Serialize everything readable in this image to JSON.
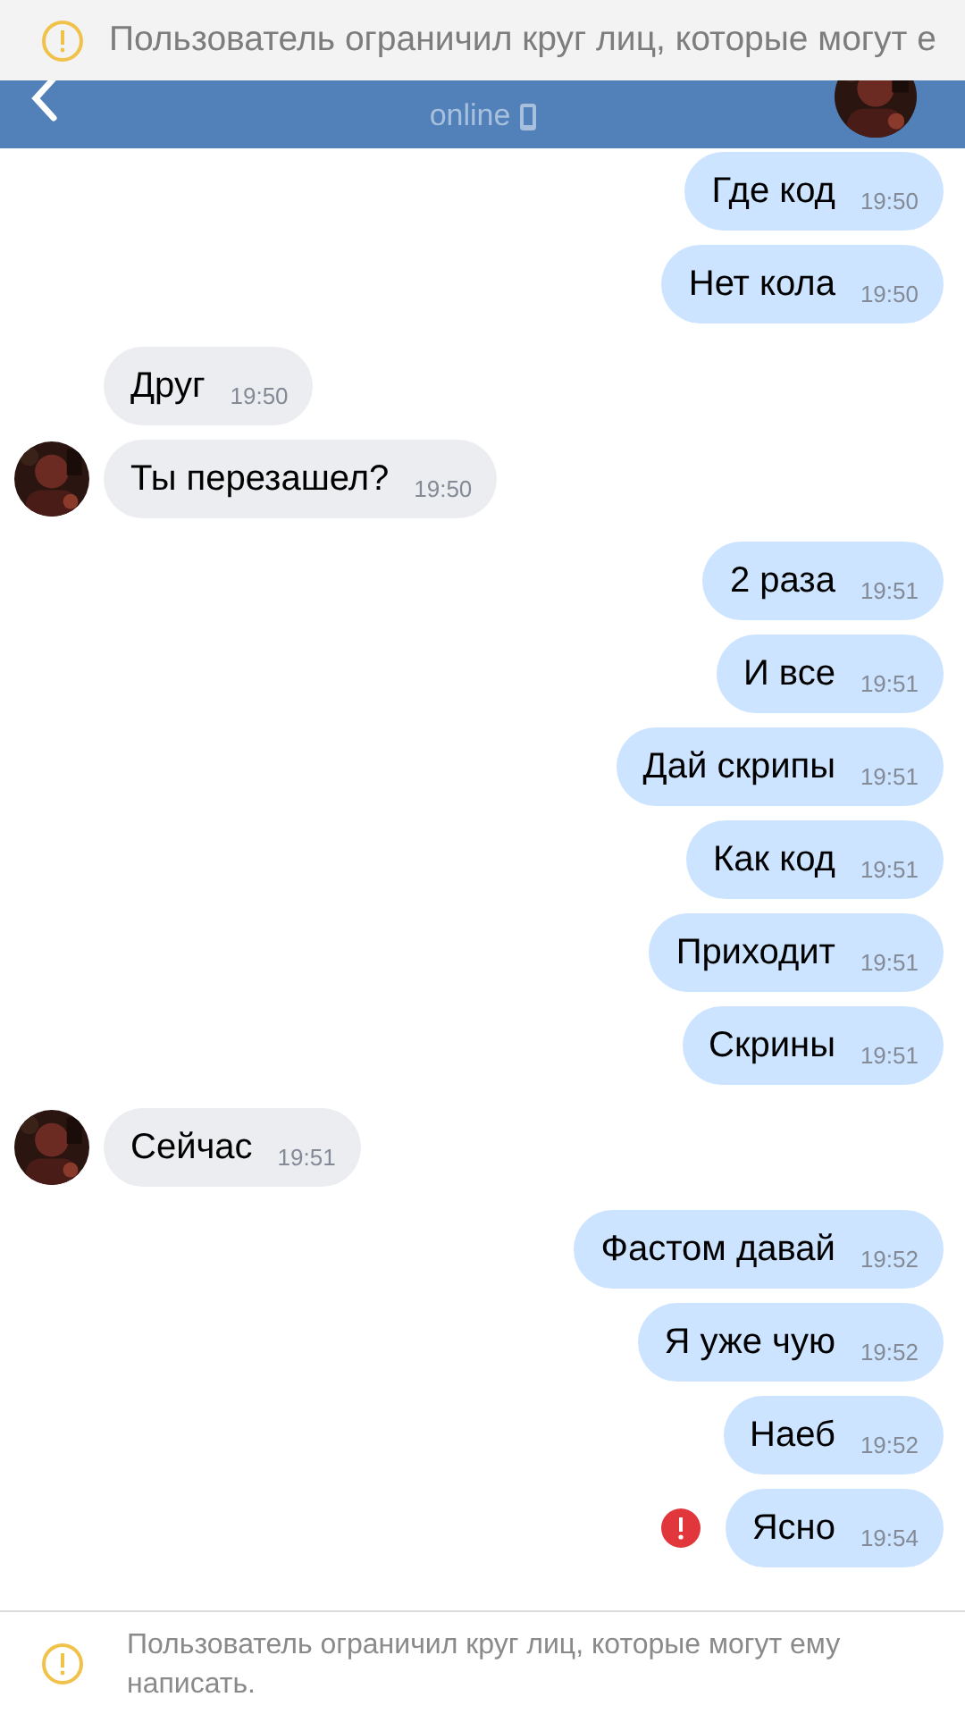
{
  "top_banner": {
    "text": "Пользователь ограничил круг лиц, которые могут е"
  },
  "header": {
    "status": "online"
  },
  "messages": [
    {
      "kind": "outgoing",
      "text": "Где код",
      "time": "19:50",
      "failed": false
    },
    {
      "kind": "outgoing",
      "text": "Нет кола",
      "time": "19:50",
      "failed": false
    },
    {
      "kind": "incoming",
      "text": "Друг",
      "time": "19:50",
      "avatar": false,
      "failed": false
    },
    {
      "kind": "incoming",
      "text": "Ты перезашел?",
      "time": "19:50",
      "avatar": true,
      "failed": false
    },
    {
      "kind": "outgoing",
      "text": "2 раза",
      "time": "19:51",
      "failed": false
    },
    {
      "kind": "outgoing",
      "text": "И все",
      "time": "19:51",
      "failed": false
    },
    {
      "kind": "outgoing",
      "text": "Дай скрипы",
      "time": "19:51",
      "failed": false
    },
    {
      "kind": "outgoing",
      "text": "Как код",
      "time": "19:51",
      "failed": false
    },
    {
      "kind": "outgoing",
      "text": "Приходит",
      "time": "19:51",
      "failed": false
    },
    {
      "kind": "outgoing",
      "text": "Скрины",
      "time": "19:51",
      "failed": false
    },
    {
      "kind": "incoming",
      "text": "Сейчас",
      "time": "19:51",
      "avatar": true,
      "failed": false
    },
    {
      "kind": "outgoing",
      "text": "Фастом давай",
      "time": "19:52",
      "failed": false
    },
    {
      "kind": "outgoing",
      "text": "Я уже чую",
      "time": "19:52",
      "failed": false
    },
    {
      "kind": "outgoing",
      "text": "Наеб",
      "time": "19:52",
      "failed": false
    },
    {
      "kind": "outgoing",
      "text": "Ясно",
      "time": "19:54",
      "failed": true
    }
  ],
  "footer_notice": {
    "text": "Пользователь ограничил круг лиц, которые могут ему написать."
  }
}
